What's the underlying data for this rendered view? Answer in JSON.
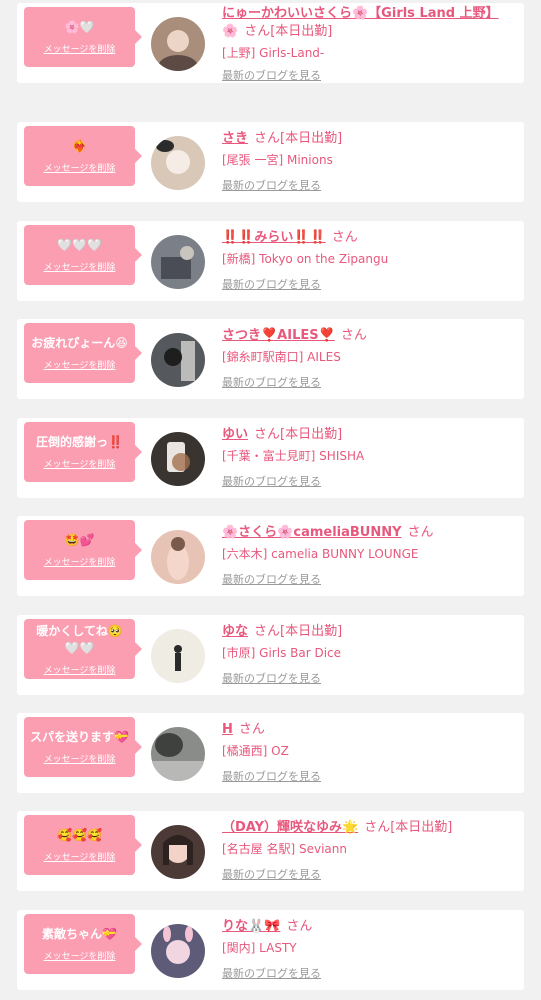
{
  "delete_label": "メッセージを削除",
  "blog_label": "最新のブログを見る",
  "san_label": "さん",
  "shift_label": "[本日出勤]",
  "cards": [
    {
      "message": "🌸🤍",
      "name": "にゅーかわいいさくら🌸【Girls Land 上野】",
      "name_wrap": "🌸",
      "shift": true,
      "shop": "[上野] Girls-Land-",
      "avatar_color": "#a98e7c"
    },
    {
      "message": "❤️‍🔥",
      "name": "さき",
      "shift": true,
      "shop": "[尾張 一宮] Minions",
      "avatar_color": "#d9c7b8"
    },
    {
      "message": "🤍🤍🤍",
      "name": "‼️‼️みらい‼️‼️",
      "shift": false,
      "shop": "[新橋] Tokyo on the Zipangu",
      "avatar_color": "#7b7f88"
    },
    {
      "message": "お疲れぴょーん😆",
      "name": "さつき❣️AILES❣️",
      "shift": false,
      "shop": "[錦糸町駅南口] AILES",
      "avatar_color": "#55585c"
    },
    {
      "message": "圧倒的感謝っ‼️",
      "name": "ゆい",
      "shift": true,
      "shop": "[千葉・富士見町] SHISHA",
      "avatar_color": "#3a3430"
    },
    {
      "message": "🤩💕",
      "name": "🌸さくら🌸cameliaBUNNY",
      "shift": false,
      "shop": "[六本木] camelia BUNNY LOUNGE",
      "avatar_color": "#e6c3b4"
    },
    {
      "message": "暖かくしてね🥺\n🤍🤍",
      "name": "ゆな",
      "shift": true,
      "shop": "[市原] Girls Bar Dice",
      "avatar_color": "#efece4"
    },
    {
      "message": "スパを送ります💝",
      "name": "H",
      "shift": false,
      "shop": "[橘通西] OZ",
      "avatar_color": "#8a8c8a"
    },
    {
      "message": "🥰🥰🥰",
      "name": "（DAY）輝咲なゆみ🌟",
      "shift": true,
      "shop": "[名古屋 名駅] Seviann",
      "avatar_color": "#4c3a36"
    },
    {
      "message": "素敵ちゃん💝",
      "name": "りな🐰🎀",
      "shift": false,
      "shop": "[関内] LASTY",
      "avatar_color": "#5d5b78"
    }
  ]
}
